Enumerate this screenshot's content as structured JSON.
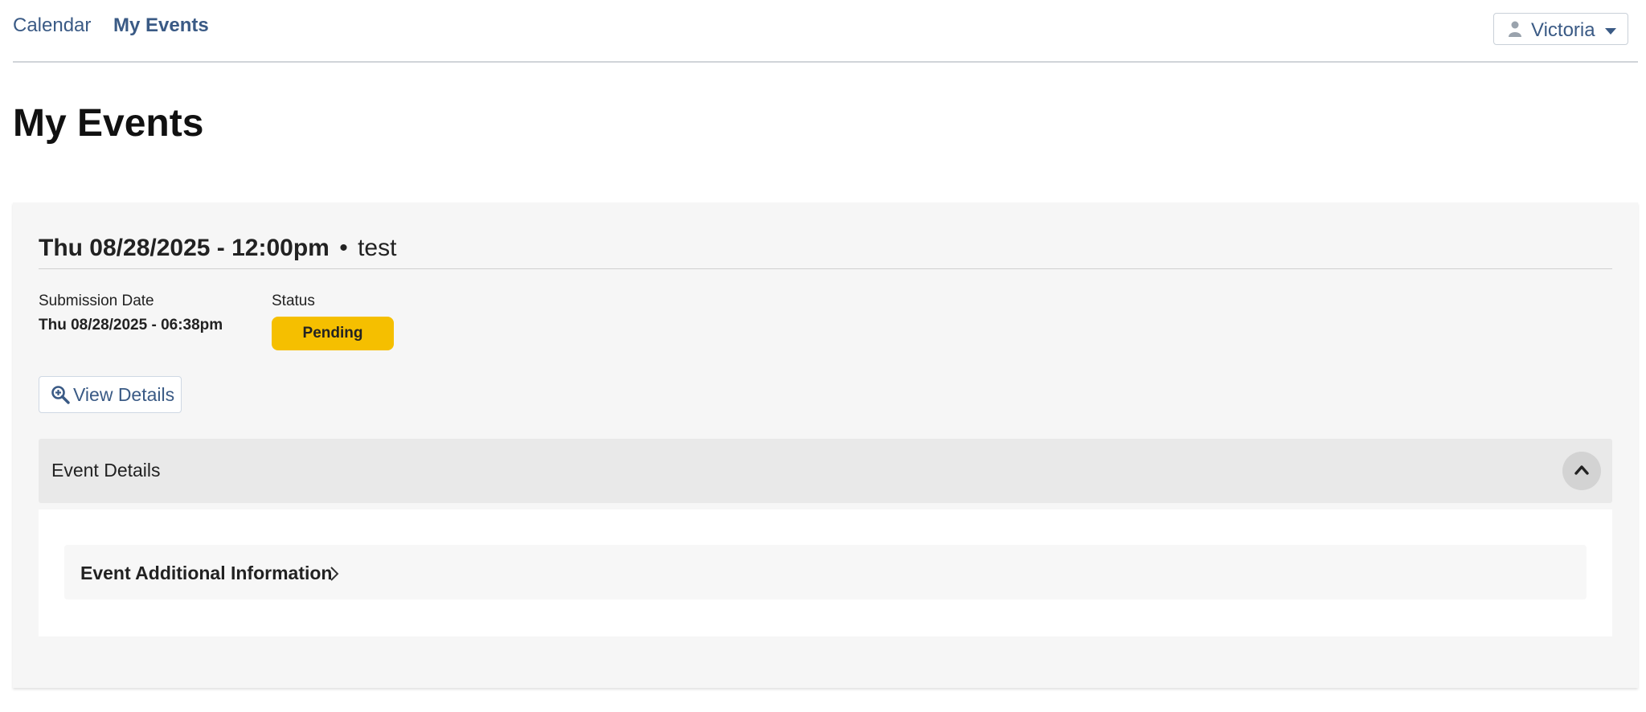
{
  "nav": {
    "calendar_label": "Calendar",
    "my_events_label": "My Events",
    "user": {
      "name": "Victoria",
      "icon": "user-icon"
    }
  },
  "page": {
    "title": "My Events"
  },
  "event": {
    "datetime": "Thu 08/28/2025 - 12:00pm",
    "separator": "•",
    "name": "test",
    "submission_date_label": "Submission Date",
    "submission_date_value": "Thu 08/28/2025 - 06:38pm",
    "status_label": "Status",
    "status_value": "Pending",
    "status_color": "#f5bf00",
    "view_details_label": "View Details"
  },
  "details": {
    "section_title": "Event Details",
    "additional_info_title": "Event Additional Information"
  },
  "colors": {
    "link": "#3a5a85",
    "card_bg": "#f6f6f6",
    "accordion_bg": "#e9e9e9"
  }
}
